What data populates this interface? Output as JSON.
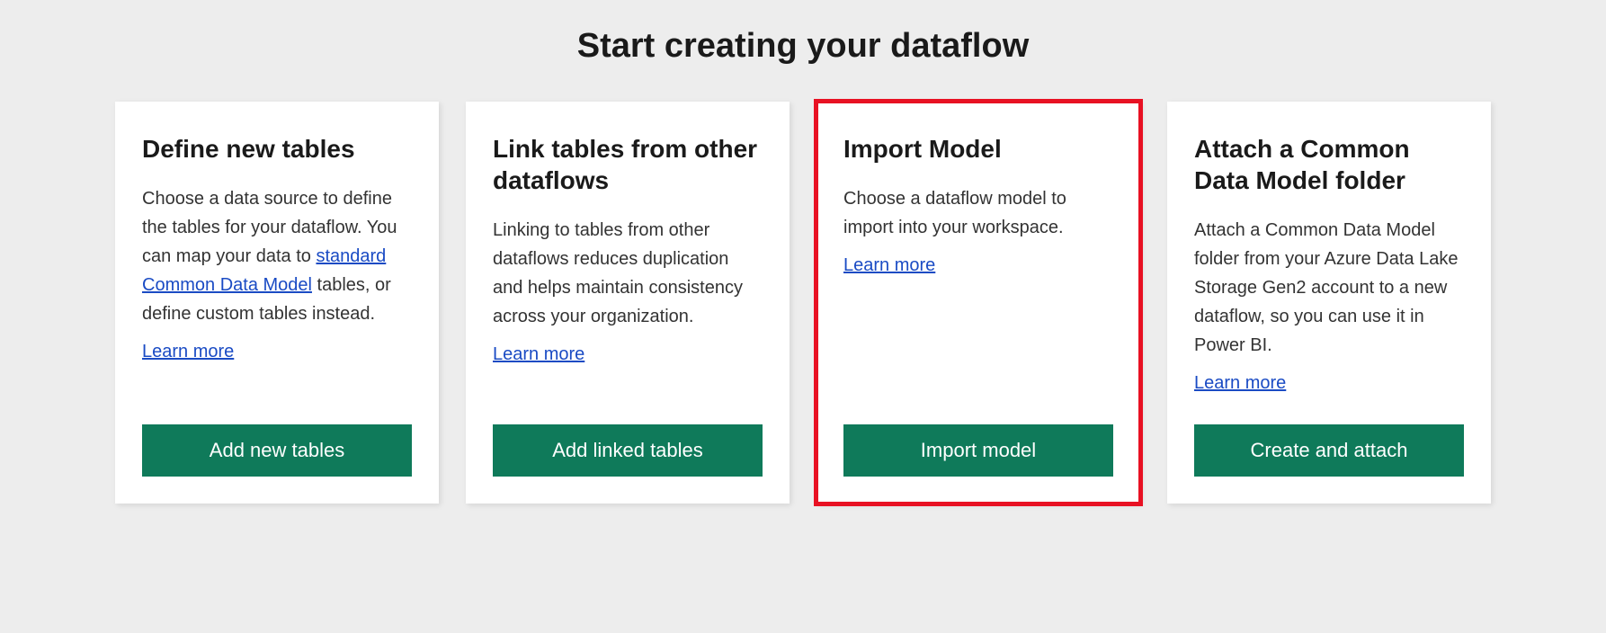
{
  "page": {
    "title": "Start creating your dataflow"
  },
  "cards": [
    {
      "title": "Define new tables",
      "description_before": "Choose a data source to define the tables for your dataflow. You can map your data to ",
      "inline_link": "standard Common Data Model",
      "description_after": " tables, or define custom tables instead.",
      "learn_more": "Learn more",
      "button": "Add new tables"
    },
    {
      "title": "Link tables from other dataflows",
      "description_before": "Linking to tables from other dataflows reduces duplication and helps maintain consistency across your organization.",
      "inline_link": "",
      "description_after": "",
      "learn_more": "Learn more",
      "button": "Add linked tables"
    },
    {
      "title": "Import Model",
      "description_before": "Choose a dataflow model to import into your workspace.",
      "inline_link": "",
      "description_after": "",
      "learn_more": "Learn more",
      "button": "Import model"
    },
    {
      "title": "Attach a Common Data Model folder",
      "description_before": "Attach a Common Data Model folder from your Azure Data Lake Storage Gen2 account to a new dataflow, so you can use it in Power BI.",
      "inline_link": "",
      "description_after": "",
      "learn_more": "Learn more",
      "button": "Create and attach"
    }
  ]
}
